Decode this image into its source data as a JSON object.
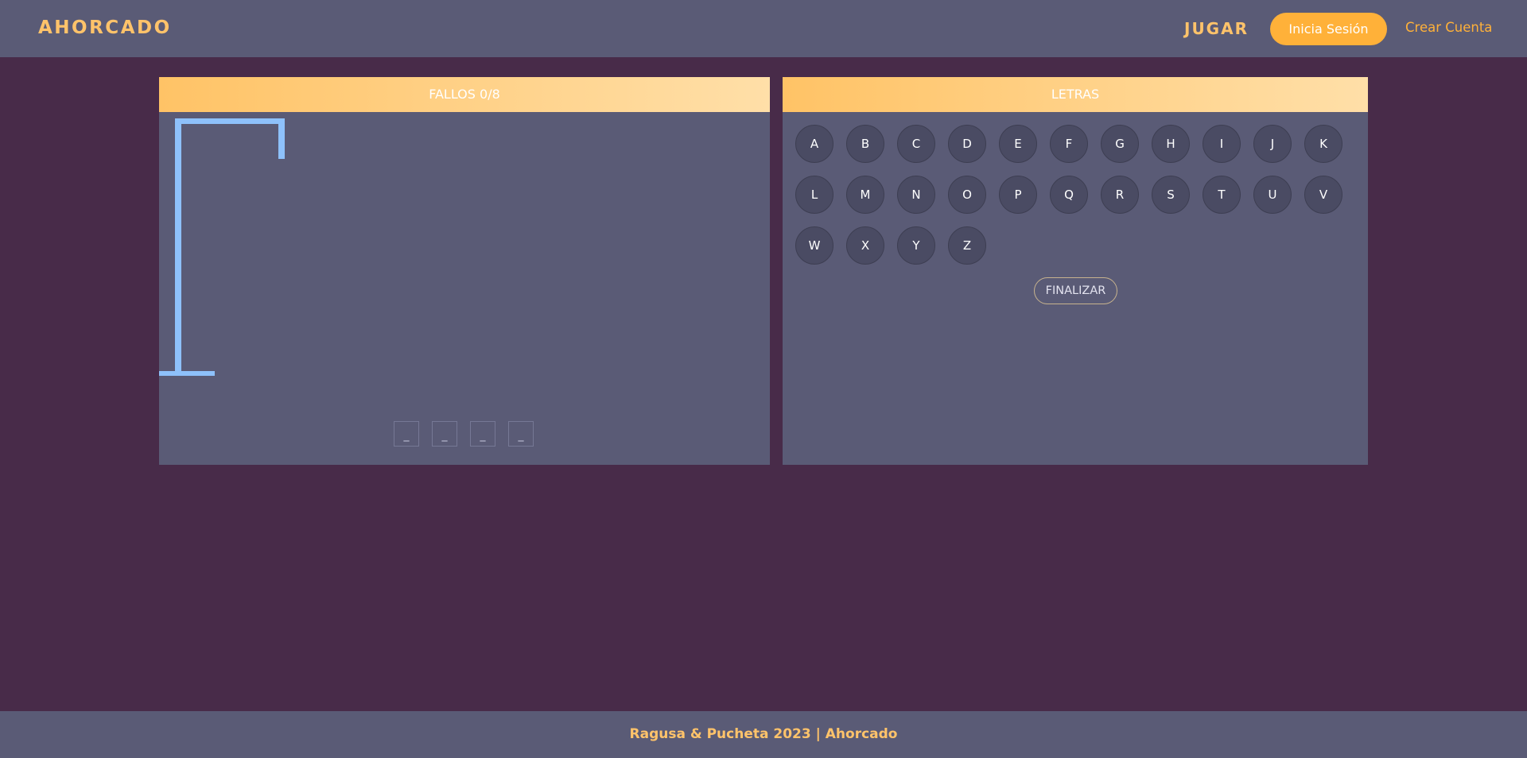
{
  "navbar": {
    "brand": "AHORCADO",
    "play_label": "JUGAR",
    "login_label": "Inicia Sesión",
    "register_label": "Crear Cuenta"
  },
  "game": {
    "fails_label": "FALLOS 0/8",
    "fails_count": 0,
    "fails_max": 8,
    "word_slots": [
      "_",
      "_",
      "_",
      "_"
    ]
  },
  "letters_panel": {
    "title": "LETRAS",
    "letters": [
      "A",
      "B",
      "C",
      "D",
      "E",
      "F",
      "G",
      "H",
      "I",
      "J",
      "K",
      "L",
      "M",
      "N",
      "O",
      "P",
      "Q",
      "R",
      "S",
      "T",
      "U",
      "V",
      "W",
      "X",
      "Y",
      "Z"
    ],
    "finish_label": "FINALIZAR"
  },
  "footer": {
    "text": "Ragusa & Pucheta 2023 | Ahorcado"
  },
  "colors": {
    "navbar_bg": "#5a5b76",
    "page_bg": "#482b49",
    "accent": "#ffc36a",
    "button": "#ffb139",
    "gallows": "#8ec1fb"
  }
}
